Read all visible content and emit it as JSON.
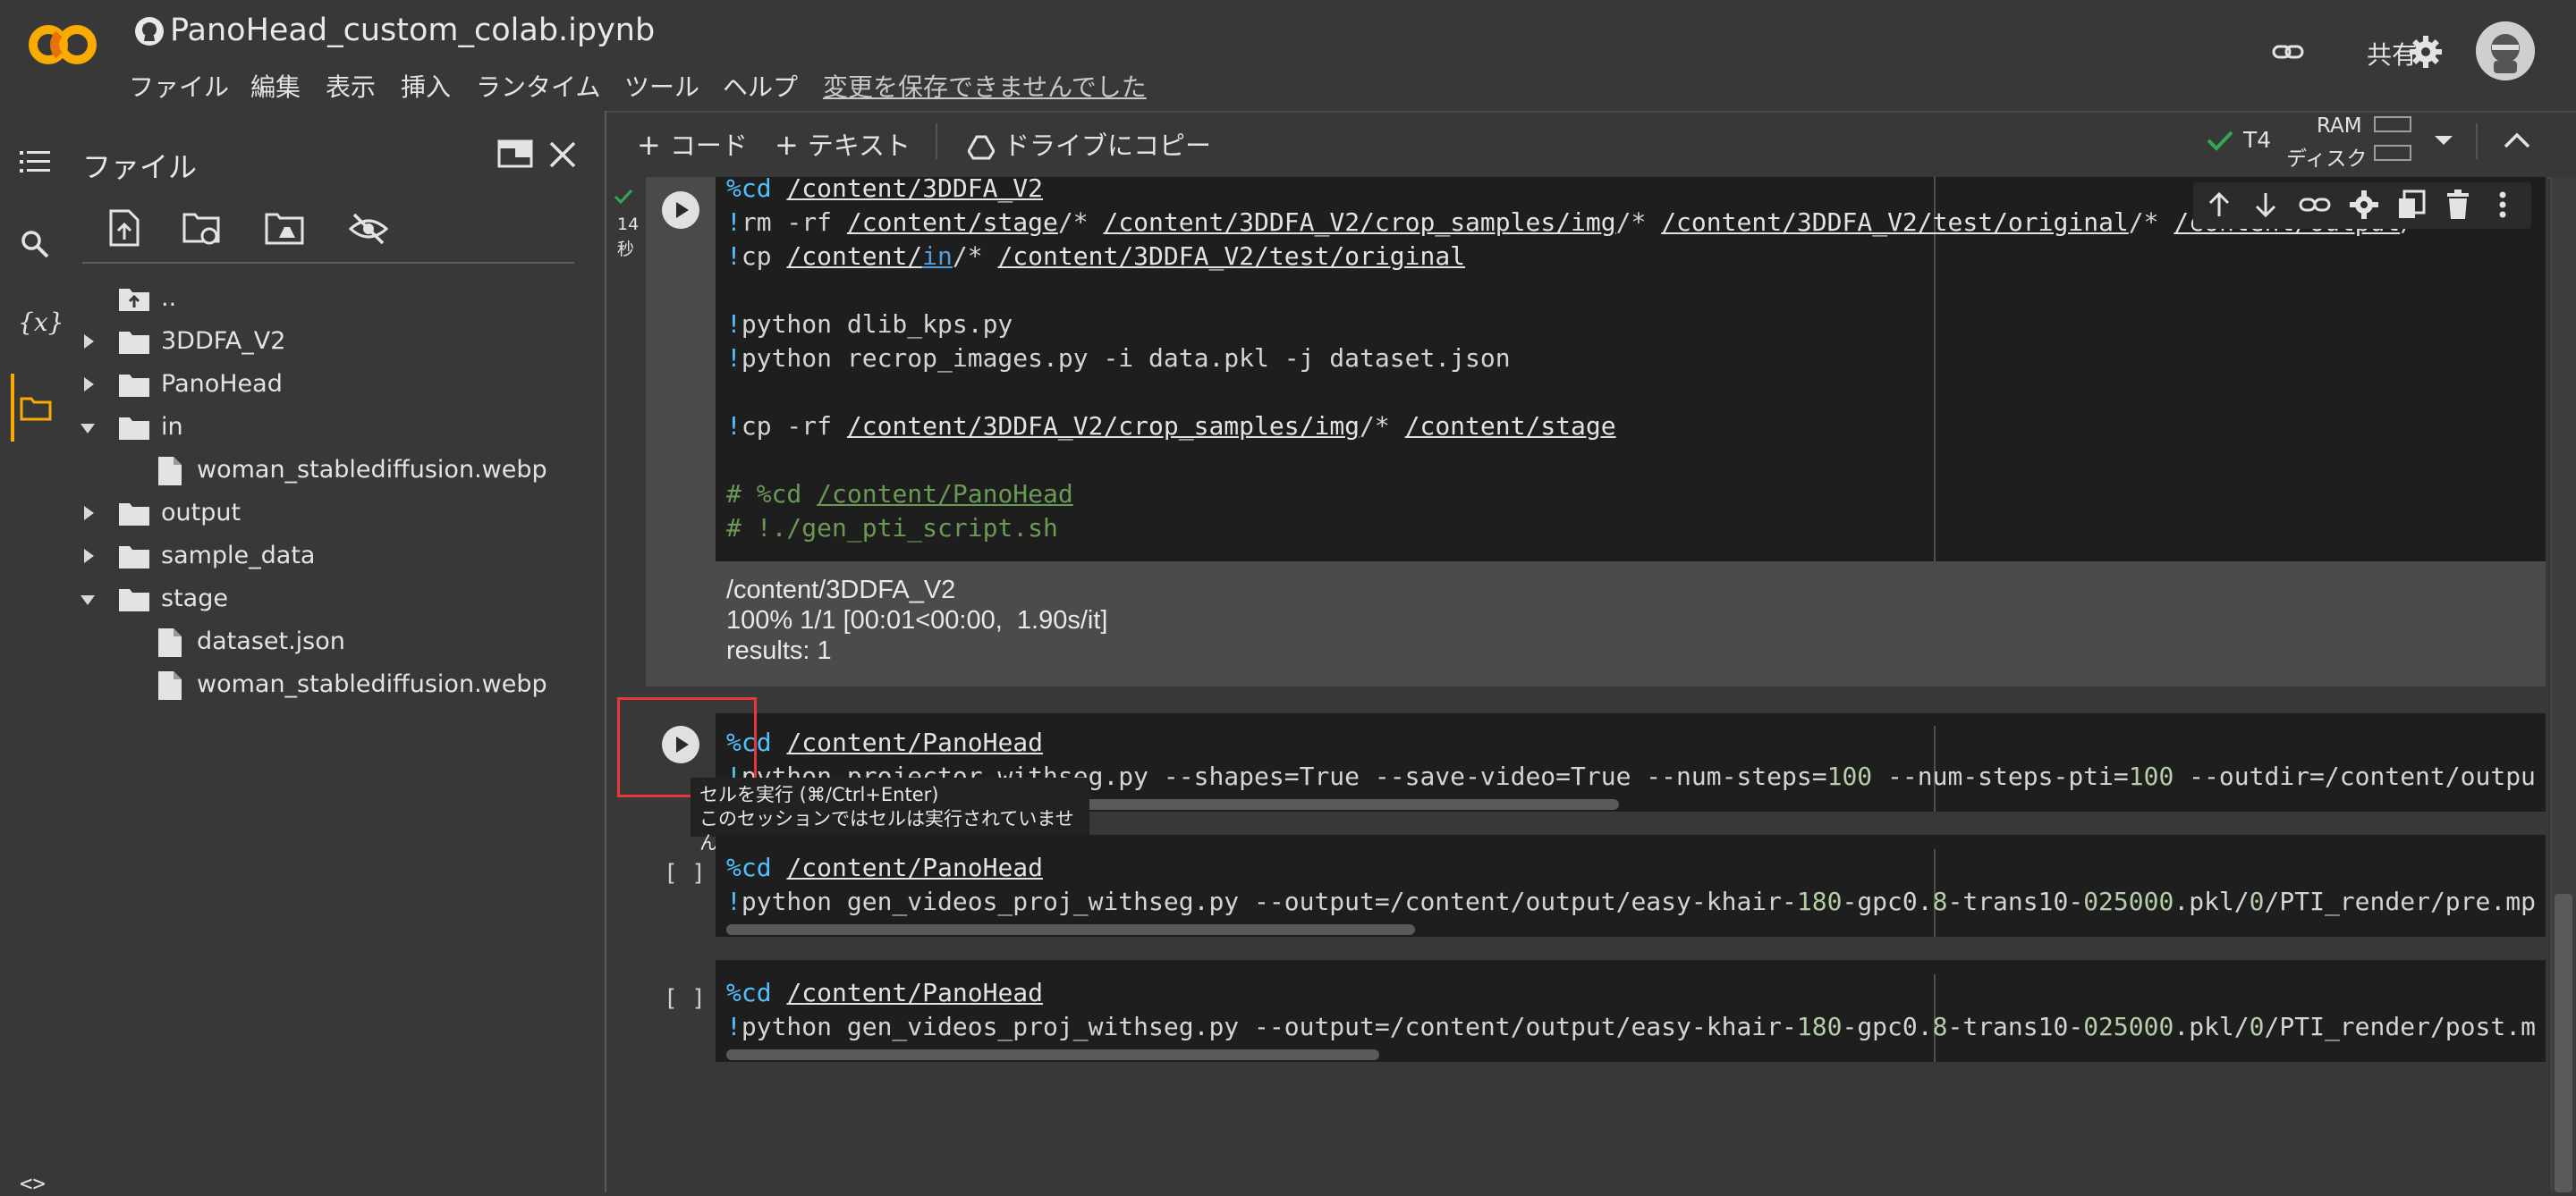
{
  "header": {
    "notebook_title": "PanoHead_custom_colab.ipynb",
    "menu": [
      "ファイル",
      "編集",
      "表示",
      "挿入",
      "ランタイム",
      "ツール",
      "ヘルプ"
    ],
    "unsaved_notice": "変更を保存できませんでした",
    "share_label": "共有"
  },
  "file_panel": {
    "title": "ファイル",
    "tree": [
      {
        "label": "..",
        "type": "parent"
      },
      {
        "label": "3DDFA_V2",
        "type": "folder",
        "expanded": false
      },
      {
        "label": "PanoHead",
        "type": "folder",
        "expanded": false
      },
      {
        "label": "in",
        "type": "folder",
        "expanded": true
      },
      {
        "label": "woman_stablediffusion.webp",
        "type": "file"
      },
      {
        "label": "output",
        "type": "folder",
        "expanded": false
      },
      {
        "label": "sample_data",
        "type": "folder",
        "expanded": false
      },
      {
        "label": "stage",
        "type": "folder",
        "expanded": true
      },
      {
        "label": "dataset.json",
        "type": "file"
      },
      {
        "label": "woman_stablediffusion.webp",
        "type": "file"
      }
    ]
  },
  "toolbar": {
    "add_code": "コード",
    "add_text": "テキスト",
    "copy_to_drive": "ドライブにコピー",
    "runtime_type": "T4",
    "ram_label": "RAM",
    "disk_label": "ディスク"
  },
  "cells": {
    "cell1": {
      "exec_time": "14",
      "exec_unit": "秒",
      "output": [
        "/content/3DDFA_V2",
        "100% 1/1 [00:01<00:00,  1.90s/it]",
        "results: 1"
      ]
    },
    "cell2": {
      "tooltip_line1": "セルを実行 (⌘/Ctrl+Enter)",
      "tooltip_line2": "このセッションではセルは実行されていません"
    },
    "cell3": {
      "bracket": "[ ]"
    },
    "cell4": {
      "bracket": "[ ]"
    }
  },
  "colors": {
    "accent_orange": "#f9ab00",
    "check_green": "#34a853",
    "focus_red": "#e53935"
  }
}
